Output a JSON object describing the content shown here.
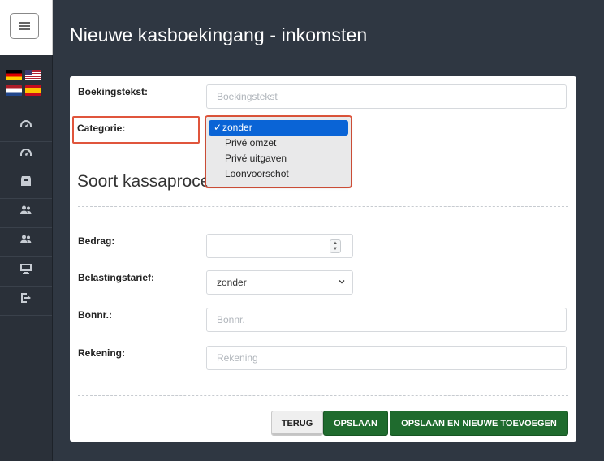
{
  "page": {
    "title": "Nieuwe kasboekingang - inkomsten"
  },
  "sidebar": {
    "languages": [
      "de",
      "us",
      "nl",
      "es"
    ],
    "items": [
      {
        "icon": "gauge-icon"
      },
      {
        "icon": "gauge-icon"
      },
      {
        "icon": "archive-box-icon"
      },
      {
        "icon": "users-icon"
      },
      {
        "icon": "users-icon"
      },
      {
        "icon": "monitor-icon"
      },
      {
        "icon": "logout-icon"
      }
    ]
  },
  "form": {
    "booking_text": {
      "label": "Boekingstekst:",
      "placeholder": "Boekingstekst"
    },
    "category": {
      "label": "Categorie:",
      "options": [
        "zonder",
        "Privé omzet",
        "Privé uitgaven",
        "Loonvoorschot"
      ],
      "selected_index": 0,
      "check_mark": "✓"
    },
    "section_title": "Soort kassaproce",
    "amount": {
      "label": "Bedrag:",
      "value": ""
    },
    "tax_rate": {
      "label": "Belastingstarief:",
      "selected": "zonder"
    },
    "receipt_no": {
      "label": "Bonnr.:",
      "placeholder": "Bonnr."
    },
    "account": {
      "label": "Rekening:",
      "placeholder": "Rekening"
    }
  },
  "buttons": {
    "back": "TERUG",
    "save": "OPSLAAN",
    "save_new": "OPSLAAN EN NIEUWE TOEVOEGEN"
  },
  "colors": {
    "background": "#2f3742",
    "sidebar": "#2a3039",
    "highlight": "#e0553c",
    "selected_option": "#0a64d6",
    "primary_button": "#1f6b2e"
  }
}
